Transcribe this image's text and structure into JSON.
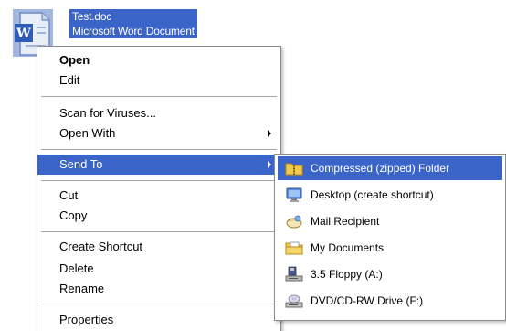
{
  "desktop_file": {
    "name": "Test.doc",
    "type": "Microsoft Word Document",
    "icon": "word-document-icon"
  },
  "context_menu": {
    "items": [
      {
        "label": "Open",
        "bold": true
      },
      {
        "label": "Edit"
      },
      {
        "label": "Scan for Viruses..."
      },
      {
        "label": "Open With",
        "submenu": true
      },
      {
        "label": "Send To",
        "submenu": true,
        "highlighted": true
      },
      {
        "label": "Cut"
      },
      {
        "label": "Copy"
      },
      {
        "label": "Create Shortcut"
      },
      {
        "label": "Delete"
      },
      {
        "label": "Rename"
      },
      {
        "label": "Properties"
      }
    ]
  },
  "send_to_menu": {
    "items": [
      {
        "label": "Compressed (zipped) Folder",
        "icon": "zipped-folder-icon",
        "highlighted": true
      },
      {
        "label": "Desktop (create shortcut)",
        "icon": "desktop-icon"
      },
      {
        "label": "Mail Recipient",
        "icon": "mail-icon"
      },
      {
        "label": "My Documents",
        "icon": "my-documents-folder-icon"
      },
      {
        "label": "3.5 Floppy (A:)",
        "icon": "floppy-drive-icon"
      },
      {
        "label": "DVD/CD-RW Drive (F:)",
        "icon": "cd-drive-icon"
      }
    ]
  },
  "colors": {
    "highlight": "#3a64c8",
    "highlight_text": "#ffffff"
  }
}
